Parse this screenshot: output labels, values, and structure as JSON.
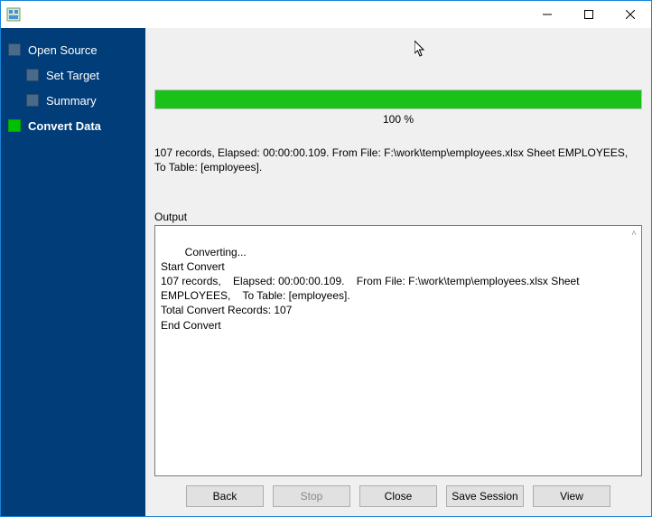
{
  "sidebar": {
    "items": [
      {
        "label": "Open Source",
        "active": false,
        "child": false
      },
      {
        "label": "Set Target",
        "active": false,
        "child": true
      },
      {
        "label": "Summary",
        "active": false,
        "child": true
      },
      {
        "label": "Convert Data",
        "active": true,
        "child": false
      }
    ]
  },
  "progress": {
    "percent_label": "100 %",
    "fill_percent": 100
  },
  "status_line": "107 records,    Elapsed: 00:00:00.109.    From File: F:\\work\\temp\\employees.xlsx Sheet EMPLOYEES,    To Table: [employees].",
  "output": {
    "label": "Output",
    "text": "Converting...\nStart Convert\n107 records,    Elapsed: 00:00:00.109.    From File: F:\\work\\temp\\employees.xlsx Sheet EMPLOYEES,    To Table: [employees].\nTotal Convert Records: 107\nEnd Convert"
  },
  "buttons": {
    "back": "Back",
    "stop": "Stop",
    "close": "Close",
    "save_session": "Save Session",
    "view": "View"
  }
}
